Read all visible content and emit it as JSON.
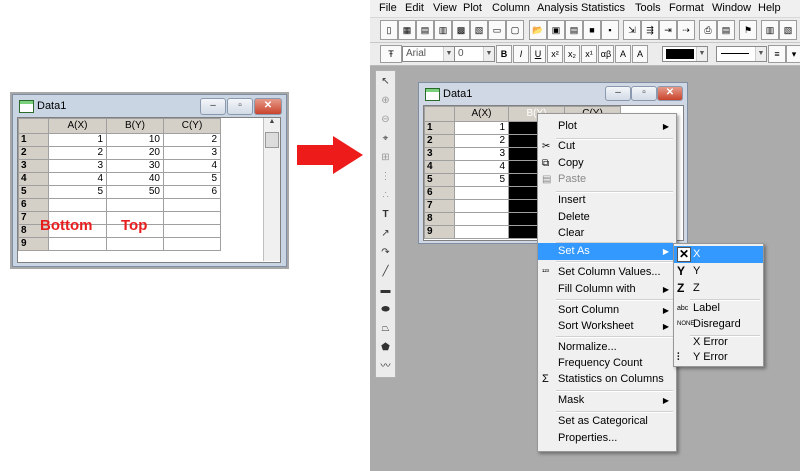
{
  "left_window": {
    "title": "Data1",
    "columns": [
      "A(X)",
      "B(Y)",
      "C(Y)"
    ],
    "rows": [
      {
        "n": "1",
        "a": "1",
        "b": "10",
        "c": "2"
      },
      {
        "n": "2",
        "a": "2",
        "b": "20",
        "c": "3"
      },
      {
        "n": "3",
        "a": "3",
        "b": "30",
        "c": "4"
      },
      {
        "n": "4",
        "a": "4",
        "b": "40",
        "c": "5"
      },
      {
        "n": "5",
        "a": "5",
        "b": "50",
        "c": "6"
      },
      {
        "n": "6",
        "a": "",
        "b": "",
        "c": ""
      },
      {
        "n": "7",
        "a": "",
        "b": "",
        "c": ""
      },
      {
        "n": "8",
        "a": "",
        "b": "",
        "c": ""
      },
      {
        "n": "9",
        "a": "",
        "b": "",
        "c": ""
      }
    ],
    "annotation_bottom": "Bottom",
    "annotation_top": "Top"
  },
  "menubar": [
    "File",
    "Edit",
    "View",
    "Plot",
    "Column",
    "Analysis",
    "Statistics",
    "Tools",
    "Format",
    "Window",
    "Help"
  ],
  "font_combo": "Arial",
  "font_size_combo": "0",
  "right_window": {
    "title": "Data1",
    "columns": [
      "A(X)",
      "B(Y)",
      "C(Y)"
    ],
    "rows": [
      "1",
      "2",
      "3",
      "4",
      "5",
      "6",
      "7",
      "8",
      "9"
    ],
    "a_values": [
      "1",
      "2",
      "3",
      "4",
      "5",
      "",
      "",
      "",
      ""
    ]
  },
  "context_menu": {
    "plot": "Plot",
    "cut": "Cut",
    "copy": "Copy",
    "paste": "Paste",
    "insert": "Insert",
    "delete": "Delete",
    "clear": "Clear",
    "set_as": "Set As",
    "set_column_values": "Set Column Values...",
    "fill_column_with": "Fill Column with",
    "sort_column": "Sort Column",
    "sort_worksheet": "Sort Worksheet",
    "normalize": "Normalize...",
    "frequency_count": "Frequency Count",
    "statistics_on_columns": "Statistics on Columns",
    "mask": "Mask",
    "set_as_categorical": "Set as Categorical",
    "properties": "Properties..."
  },
  "set_as_submenu": {
    "x": "X",
    "y": "Y",
    "z": "Z",
    "label": "Label",
    "disregard": "Disregard",
    "x_error": "X Error",
    "y_error": "Y Error"
  },
  "colors": {
    "arrow": "#ee1b1b",
    "annotation": "#e81e1e",
    "highlight": "#3399ff"
  }
}
